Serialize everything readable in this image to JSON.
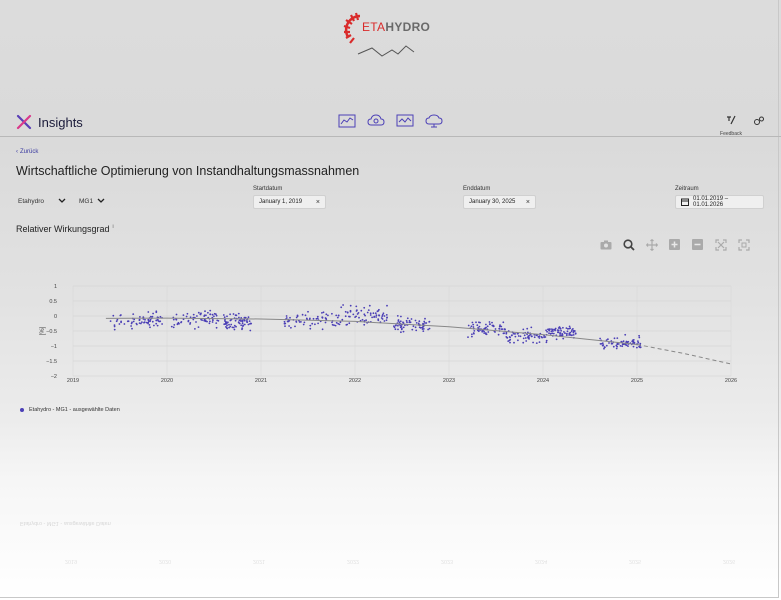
{
  "app": {
    "logo_text_eta": "ETA",
    "logo_text_hydro": "HYDRO",
    "brand_title": "Insights",
    "feedback_label": "Feedback",
    "nav_icons": [
      "chart-line-icon",
      "cloud-brain-icon",
      "monitor-chart-icon",
      "cloud-settings-icon"
    ]
  },
  "page": {
    "back_label": "Zurück",
    "title": "Wirtschaftliche Optimierung von Instandhaltungsmassnahmen"
  },
  "filters": {
    "plant_value": "Etahydro",
    "unit_value": "MG1",
    "start_label": "Startdatum",
    "start_value": "January 1, 2019",
    "end_label": "Enddatum",
    "end_value": "January 30, 2025",
    "range_label": "Zeitraum",
    "range_value": "01.01.2019 – 01.01.2026"
  },
  "chart_section": {
    "title": "Relativer Wirkungsgrad",
    "info_marker": "i",
    "toolbar": [
      "camera-icon",
      "zoom-icon",
      "pan-icon",
      "zoom-in-icon",
      "zoom-out-icon",
      "autoscale-icon",
      "reset-axes-icon"
    ]
  },
  "colors": {
    "accent": "#4b3fb6",
    "brand_red": "#d92b2b",
    "trend": "#888888"
  },
  "chart_data": {
    "type": "scatter",
    "title": "Relativer Wirkungsgrad",
    "ylabel": "[%]",
    "xlabel": "",
    "xlim": [
      2019,
      2026
    ],
    "ylim": [
      -2,
      1
    ],
    "x_ticks": [
      "2019",
      "2020",
      "2021",
      "2022",
      "2023",
      "2024",
      "2025",
      "2026"
    ],
    "y_ticks": [
      "1",
      "0.5",
      "0",
      "−0.5",
      "−1",
      "−1.5",
      "−2"
    ],
    "legend": [
      "Etahydro - MG1 - ausgewählte Daten"
    ],
    "series": [
      {
        "name": "Etahydro - MG1 - ausgewählte Daten",
        "clusters": [
          {
            "x_start": 2019.4,
            "x_end": 2019.95,
            "y_center": -0.15,
            "spread": 0.35
          },
          {
            "x_start": 2020.05,
            "x_end": 2020.55,
            "y_center": -0.1,
            "spread": 0.4
          },
          {
            "x_start": 2020.6,
            "x_end": 2020.9,
            "y_center": -0.2,
            "spread": 0.35
          },
          {
            "x_start": 2021.25,
            "x_end": 2021.85,
            "y_center": -0.15,
            "spread": 0.35
          },
          {
            "x_start": 2021.85,
            "x_end": 2022.35,
            "y_center": 0.0,
            "spread": 0.45
          },
          {
            "x_start": 2022.4,
            "x_end": 2022.8,
            "y_center": -0.3,
            "spread": 0.35
          },
          {
            "x_start": 2023.2,
            "x_end": 2023.6,
            "y_center": -0.45,
            "spread": 0.4
          },
          {
            "x_start": 2023.6,
            "x_end": 2024.05,
            "y_center": -0.65,
            "spread": 0.35
          },
          {
            "x_start": 2024.05,
            "x_end": 2024.35,
            "y_center": -0.55,
            "spread": 0.3
          },
          {
            "x_start": 2024.6,
            "x_end": 2025.05,
            "y_center": -0.9,
            "spread": 0.3
          }
        ],
        "count_approx": 700
      },
      {
        "name": "trend",
        "x": [
          2019.35,
          2020.0,
          2021.0,
          2022.0,
          2023.0,
          2024.0,
          2025.0,
          2025.5,
          2026.0
        ],
        "y": [
          -0.08,
          -0.07,
          -0.1,
          -0.18,
          -0.36,
          -0.62,
          -0.95,
          -1.25,
          -1.6
        ],
        "solid_until": 2025.0
      }
    ]
  }
}
